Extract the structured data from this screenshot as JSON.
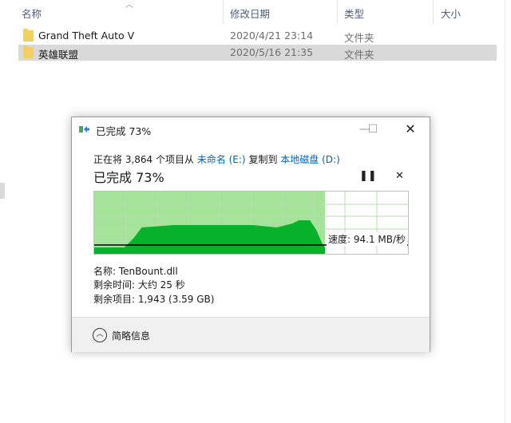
{
  "explorer": {
    "columns": {
      "name": "名称",
      "date": "修改日期",
      "type": "类型",
      "size": "大小"
    },
    "rows": [
      {
        "name": "Grand Theft Auto V",
        "date": "2020/4/21 23:14",
        "type": "文件夹",
        "selected": false
      },
      {
        "name": "英雄联盟",
        "date": "2020/5/16 21:35",
        "type": "文件夹",
        "selected": true
      }
    ]
  },
  "dialog": {
    "title": "已完成 73%",
    "icons": {
      "app": "copy-progress-icon",
      "minimize": "minimize-icon",
      "maximize": "maximize-icon",
      "close": "close-icon",
      "pause": "pause-icon",
      "cancel": "cancel-icon",
      "details": "chevron-up-icon"
    },
    "description": {
      "prefix": "正在将 3,864 个项目从",
      "source": "未命名 (E:)",
      "middle": "复制到",
      "destination": "本地磁盘 (D:)"
    },
    "progress_text": "已完成 73%",
    "progress_fraction": 0.73,
    "speed": "速度: 94.1 MB/秒",
    "details": {
      "name": "名称: TenBount.dll",
      "time_remaining": "剩余时间: 大约 25 秒",
      "items_remaining": "剩余项目: 1,943 (3.59 GB)"
    },
    "footer_label": "简略信息",
    "colors": {
      "progress_fill": "#a6e39a",
      "throughput": "#07b12a",
      "grid": "#b4dcb0",
      "link": "#0062b8"
    }
  }
}
